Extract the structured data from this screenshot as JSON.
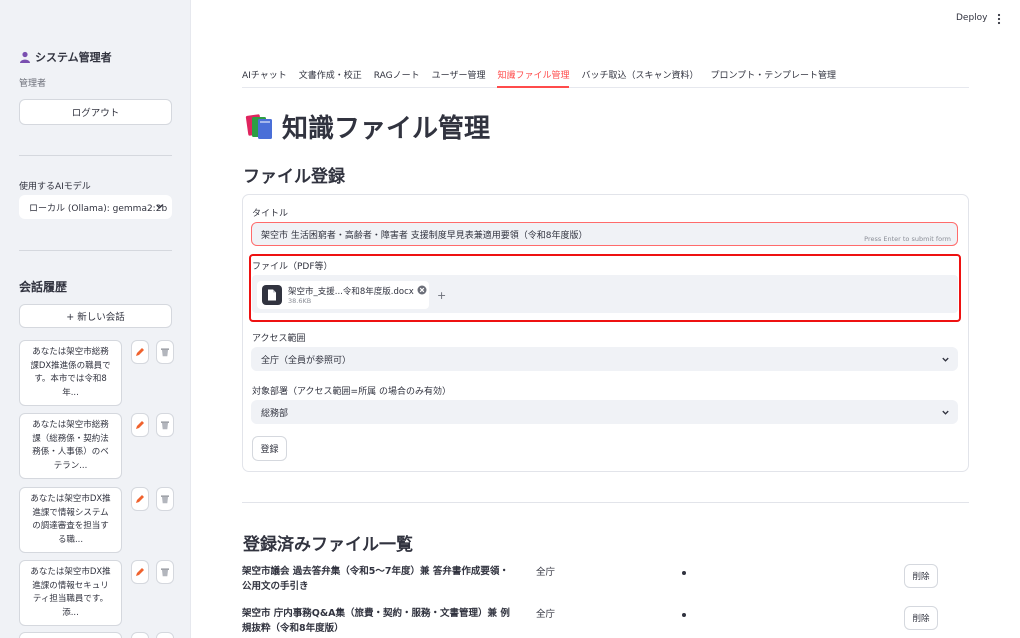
{
  "sidebar": {
    "user_name": "システム管理者",
    "role": "管理者",
    "logout_label": "ログアウト",
    "model_label": "使用するAIモデル",
    "model_value": "ローカル (Ollama): gemma2:2b",
    "history_title": "会話履歴",
    "new_chat_label": "+ 新しい会話",
    "history": [
      {
        "line1": "あなたは架空市総務",
        "line2": "課DX推進係の職員で",
        "line3": "す。本市では令和8",
        "line4": "年..."
      },
      {
        "line1": "あなたは架空市総務",
        "line2": "課（総務係・契約法",
        "line3": "務係・人事係）のベ",
        "line4": "テラン..."
      },
      {
        "line1": "あなたは架空市DX推",
        "line2": "進課で情報システム",
        "line3": "の調達審査を担当す",
        "line4": "る職..."
      },
      {
        "line1": "あなたは架空市DX推",
        "line2": "進課の情報セキュリ",
        "line3": "ティ担当職員です。",
        "line4": "添..."
      }
    ]
  },
  "topbar": {
    "deploy_label": "Deploy"
  },
  "tabs": [
    {
      "label": "AIチャット"
    },
    {
      "label": "文書作成・校正"
    },
    {
      "label": "RAGノート"
    },
    {
      "label": "ユーザー管理"
    },
    {
      "label": "知識ファイル管理",
      "active": true
    },
    {
      "label": "バッチ取込（スキャン資料）"
    },
    {
      "label": "プロンプト・テンプレート管理"
    }
  ],
  "page": {
    "title": "知識ファイル管理",
    "register_heading": "ファイル登録",
    "list_heading": "登録済みファイル一覧"
  },
  "form": {
    "title_label": "タイトル",
    "title_value": "架空市 生活困窮者・高齢者・障害者 支援制度早見表兼適用要領（令和8年度版）",
    "submit_hint": "Press Enter to submit form",
    "file_label": "ファイル（PDF等）",
    "file_name": "架空市_支援...令和8年度版.docx",
    "file_size": "38.6KB",
    "file_add": "+",
    "access_label": "アクセス範囲",
    "access_value": "全庁（全員が参照可）",
    "dept_label": "対象部署（アクセス範囲=所属 の場合のみ有効）",
    "dept_value": "総務部",
    "submit_label": "登録"
  },
  "files": [
    {
      "title_line1": "架空市議会 過去答弁集（令和5〜7年度）兼 答弁書作成要領・",
      "title_line2": "公用文の手引き",
      "scope": "全庁",
      "delete_label": "削除"
    },
    {
      "title_line1": "架空市 庁内事務Q&A集（旅費・契約・服務・文書管理）兼 例",
      "title_line2": "規抜粋（令和8年度版）",
      "scope": "全庁",
      "delete_label": "削除"
    }
  ],
  "colors": {
    "accent": "#ff4b4b",
    "highlight_border": "#e11111",
    "sidebar_bg": "#f0f2f6"
  }
}
